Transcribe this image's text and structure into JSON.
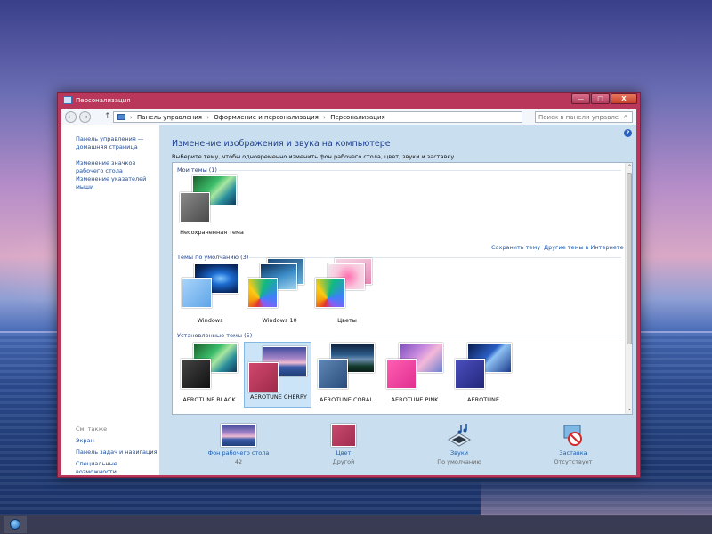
{
  "window": {
    "title": "Персонализация",
    "minimize": "—",
    "maximize": "□",
    "close": "X"
  },
  "address": {
    "back": "←",
    "forward": "→",
    "up": "↑",
    "crumbs": [
      "Панель управления",
      "Оформление и персонализация",
      "Персонализация"
    ],
    "separator": "›",
    "dropdown": "⌄",
    "refresh": "↻",
    "search_placeholder": "Поиск в панели управления",
    "search_icon": "⌕"
  },
  "sidebar": {
    "links": [
      "Панель управления — домашняя страница",
      "Изменение значков рабочего стола",
      "Изменение указателей мыши"
    ],
    "see_also_label": "См. также",
    "see_also": [
      "Экран",
      "Панель задач и навигация",
      "Специальные возможности"
    ]
  },
  "main": {
    "help": "?",
    "title": "Изменение изображения и звука на компьютере",
    "description": "Выберите тему, чтобы одновременно изменить фон рабочего стола, цвет, звуки и заставку.",
    "groups": {
      "my": {
        "heading": "Мои темы (1)",
        "themes": [
          {
            "label": "Несохраненная тема"
          }
        ]
      },
      "save_link": "Сохранить тему",
      "more_link": "Другие темы в Интернете",
      "default": {
        "heading": "Темы по умолчанию (3)",
        "themes": [
          {
            "label": "Windows"
          },
          {
            "label": "Windows 10"
          },
          {
            "label": "Цветы"
          }
        ]
      },
      "installed": {
        "heading": "Установленные темы (5)",
        "themes": [
          {
            "label": "AEROTUNE BLACK"
          },
          {
            "label": "AEROTUNE CHERRY",
            "selected": true
          },
          {
            "label": "AEROTUNE CORAL"
          },
          {
            "label": "AEROTUNE PINK"
          },
          {
            "label": "AEROTUNE"
          }
        ]
      }
    },
    "scroll_up": "⌃",
    "scroll_down": "⌄",
    "bottom": [
      {
        "label": "Фон рабочего стола",
        "sub": "42"
      },
      {
        "label": "Цвет",
        "sub": "Другой"
      },
      {
        "label": "Звуки",
        "sub": "По умолчанию"
      },
      {
        "label": "Заставка",
        "sub": "Отсутствует"
      }
    ]
  },
  "colors": {
    "titlebar": "#b8375a",
    "link": "#1a5cb0",
    "heading": "#1e3f8f",
    "main_bg": "#c9dff0",
    "cherry": "#b83559"
  }
}
